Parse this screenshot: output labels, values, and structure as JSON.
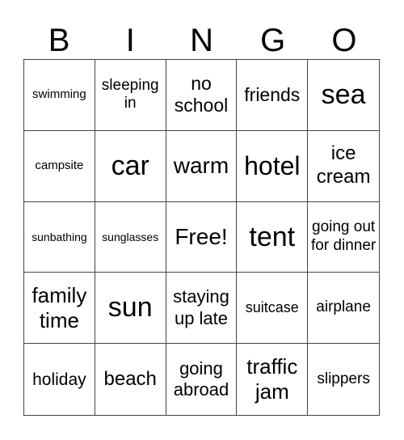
{
  "header": [
    "B",
    "I",
    "N",
    "G",
    "O"
  ],
  "cells": [
    {
      "text": "swimming",
      "size": 15
    },
    {
      "text": "sleeping in",
      "size": 19
    },
    {
      "text": "no school",
      "size": 23
    },
    {
      "text": "friends",
      "size": 23
    },
    {
      "text": "sea",
      "size": 34
    },
    {
      "text": "campsite",
      "size": 15
    },
    {
      "text": "car",
      "size": 34
    },
    {
      "text": "warm",
      "size": 28
    },
    {
      "text": "hotel",
      "size": 32
    },
    {
      "text": "ice cream",
      "size": 24
    },
    {
      "text": "sunbathing",
      "size": 14
    },
    {
      "text": "sunglasses",
      "size": 14
    },
    {
      "text": "Free!",
      "size": 28
    },
    {
      "text": "tent",
      "size": 34
    },
    {
      "text": "going out for dinner",
      "size": 19
    },
    {
      "text": "family time",
      "size": 26
    },
    {
      "text": "sun",
      "size": 34
    },
    {
      "text": "staying up late",
      "size": 22
    },
    {
      "text": "suitcase",
      "size": 18
    },
    {
      "text": "airplane",
      "size": 19
    },
    {
      "text": "holiday",
      "size": 21
    },
    {
      "text": "beach",
      "size": 24
    },
    {
      "text": "going abroad",
      "size": 22
    },
    {
      "text": "traffic jam",
      "size": 26
    },
    {
      "text": "slippers",
      "size": 19
    }
  ]
}
